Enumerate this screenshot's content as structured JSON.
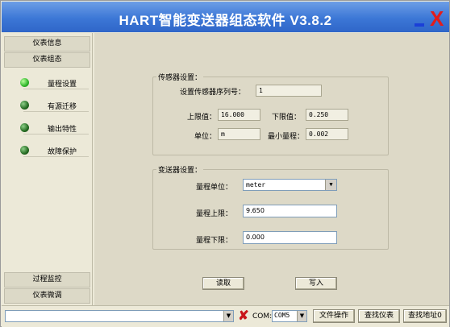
{
  "window": {
    "title": "HART智能变送器组态软件   V3.8.2",
    "minimize_icon": "minimize-icon",
    "close_icon": "close-x-icon",
    "close_glyph": "X"
  },
  "nav": {
    "top_items": [
      {
        "label": "仪表信息"
      },
      {
        "label": "仪表组态"
      }
    ],
    "sub_items": [
      {
        "label": "量程设置",
        "active": true
      },
      {
        "label": "有源迁移",
        "active": false
      },
      {
        "label": "输出特性",
        "active": false
      },
      {
        "label": "故障保护",
        "active": false
      }
    ],
    "bottom_items": [
      {
        "label": "过程监控"
      },
      {
        "label": "仪表微调"
      }
    ]
  },
  "sensor_settings": {
    "legend": "传感器设置：",
    "serial_label": "设置传感器序列号：",
    "serial_value": "1",
    "upper_label": "上限值：",
    "upper_value": "16.000",
    "lower_label": "下限值：",
    "lower_value": "0.250",
    "unit_label": "单位：",
    "unit_value": "m",
    "min_span_label": "最小量程：",
    "min_span_value": "0.002"
  },
  "transmitter_settings": {
    "legend": "变送器设置：",
    "range_unit_label": "量程单位：",
    "range_unit_value": "meter",
    "range_upper_label": "量程上限：",
    "range_upper_value": "9.650",
    "range_lower_label": "量程下限：",
    "range_lower_value": "0.000"
  },
  "actions": {
    "read_label": "读取",
    "write_label": "写入"
  },
  "statusbar": {
    "device_combo_value": "",
    "tool_icon": "tool-x-icon",
    "tool_glyph": "✘",
    "com_label": "COM:",
    "com_value": "COM5",
    "file_ops_label": "文件操作",
    "find_device_label": "查找仪表",
    "find_address_label": "查找地址0"
  },
  "colors": {
    "title_bar": "#3c77d6",
    "close_x": "#e21c1c",
    "main_bg": "#ddd9c7",
    "active_dot": "#2fb52a"
  }
}
